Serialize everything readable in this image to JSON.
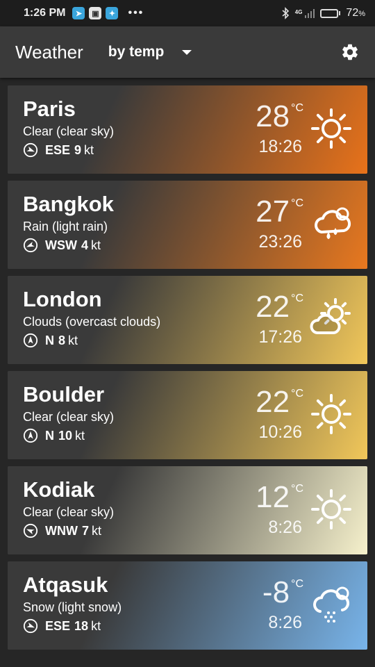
{
  "status_bar": {
    "time": "1:26 PM",
    "apps": [
      "telegram-icon",
      "lock-app-icon",
      "twitter-icon"
    ],
    "network": "4G",
    "battery_pct": "72",
    "battery_level": 0.72
  },
  "app_bar": {
    "title": "Weather",
    "sort_label": "by temp",
    "settings_icon": "gear-icon"
  },
  "cities": [
    {
      "name": "Paris",
      "desc": "Clear (clear sky)",
      "wind_dir": "ESE",
      "wind_speed": "9",
      "wind_unit": "kt",
      "temp": "28",
      "unit": "°C",
      "time": "18:26",
      "icon": "sun-icon",
      "color": "#e8721a"
    },
    {
      "name": "Bangkok",
      "desc": "Rain (light rain)",
      "wind_dir": "WSW",
      "wind_speed": "4",
      "wind_unit": "kt",
      "temp": "27",
      "unit": "°C",
      "time": "23:26",
      "icon": "cloud-rain-icon",
      "color": "#e8781f"
    },
    {
      "name": "London",
      "desc": "Clouds (overcast clouds)",
      "wind_dir": "N",
      "wind_speed": "8",
      "wind_unit": "kt",
      "temp": "22",
      "unit": "°C",
      "time": "17:26",
      "icon": "cloud-sun-icon",
      "color": "#f1c75a"
    },
    {
      "name": "Boulder",
      "desc": "Clear (clear sky)",
      "wind_dir": "N",
      "wind_speed": "10",
      "wind_unit": "kt",
      "temp": "22",
      "unit": "°C",
      "time": "10:26",
      "icon": "sun-icon",
      "color": "#f1c75a"
    },
    {
      "name": "Kodiak",
      "desc": "Clear (clear sky)",
      "wind_dir": "WNW",
      "wind_speed": "7",
      "wind_unit": "kt",
      "temp": "12",
      "unit": "°C",
      "time": "8:26",
      "icon": "sun-icon",
      "color": "#f6f1cc"
    },
    {
      "name": "Atqasuk",
      "desc": "Snow (light snow)",
      "wind_dir": "ESE",
      "wind_speed": "18",
      "wind_unit": "kt",
      "temp": "-8",
      "unit": "°C",
      "time": "8:26",
      "icon": "cloud-snow-icon",
      "color": "#78b4ea"
    }
  ]
}
